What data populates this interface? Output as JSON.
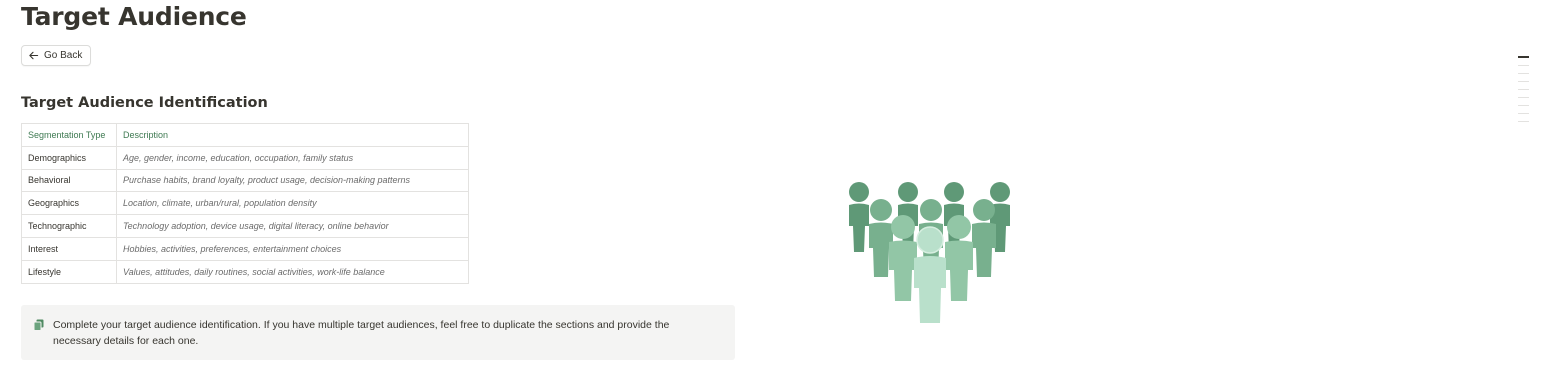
{
  "page": {
    "title": "Target Audience"
  },
  "back_button": {
    "label": "Go Back",
    "icon": "arrow-left-icon"
  },
  "section": {
    "heading": "Target Audience Identification"
  },
  "table": {
    "headers": [
      "Segmentation Type",
      "Description"
    ],
    "rows": [
      {
        "type": "Demographics",
        "description": "Age, gender, income, education, occupation, family status"
      },
      {
        "type": "Behavioral",
        "description": "Purchase habits, brand loyalty, product usage, decision-making patterns"
      },
      {
        "type": "Geographics",
        "description": "Location, climate, urban/rural, population density"
      },
      {
        "type": "Technographic",
        "description": "Technology adoption, device usage, digital literacy, online behavior"
      },
      {
        "type": "Interest",
        "description": "Hobbies, activities, preferences, entertainment choices"
      },
      {
        "type": "Lifestyle",
        "description": "Values, attitudes, daily routines, social activities, work-life balance"
      }
    ]
  },
  "callout": {
    "icon": "copy-icon",
    "text": "Complete your target audience identification. If you have multiple target audiences, feel free to duplicate the sections and provide the necessary details for each one."
  },
  "illustration": {
    "icon": "people-group-icon",
    "colors": [
      "#5f9977",
      "#78b08e",
      "#92c6a6",
      "#b9e0cb"
    ]
  },
  "colors": {
    "accent": "#3f7a52",
    "text": "#37352f",
    "callout_bg": "#f4f4f3"
  }
}
